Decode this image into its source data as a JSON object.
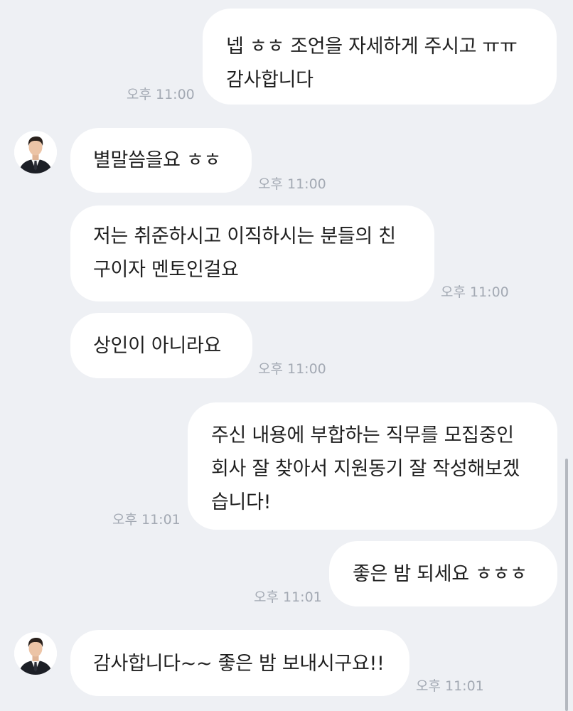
{
  "messages": [
    {
      "sender": "me",
      "lines": [
        "넵 ㅎㅎ 조언을 자세하게 주시고 ㅠㅠ",
        "감사합니다"
      ],
      "time": "오후 11:00"
    },
    {
      "sender": "other",
      "lines": [
        "별말씀을요 ㅎㅎ"
      ],
      "time": "오후 11:00"
    },
    {
      "sender": "other",
      "lines": [
        "저는 취준하시고 이직하시는 분들의 친",
        "구이자 멘토인걸요"
      ],
      "time": "오후 11:00"
    },
    {
      "sender": "other",
      "lines": [
        "상인이 아니라요"
      ],
      "time": "오후 11:00"
    },
    {
      "sender": "me",
      "lines": [
        "주신 내용에 부합하는 직무를 모집중인",
        "회사 잘 찾아서 지원동기 잘 작성해보겠",
        "습니다!"
      ],
      "time": "오후 11:01"
    },
    {
      "sender": "me",
      "lines": [
        "좋은 밤 되세요 ㅎㅎㅎ"
      ],
      "time": "오후 11:01"
    },
    {
      "sender": "other",
      "lines": [
        "감사합니다~~ 좋은 밤 보내시구요!!"
      ],
      "time": "오후 11:01"
    }
  ],
  "colors": {
    "background": "#eef0f4",
    "bubble": "#ffffff",
    "text": "#1f1f1f",
    "timestamp": "#a3a9b3"
  },
  "icons": {
    "avatar": "profile-photo-man-in-suit"
  }
}
